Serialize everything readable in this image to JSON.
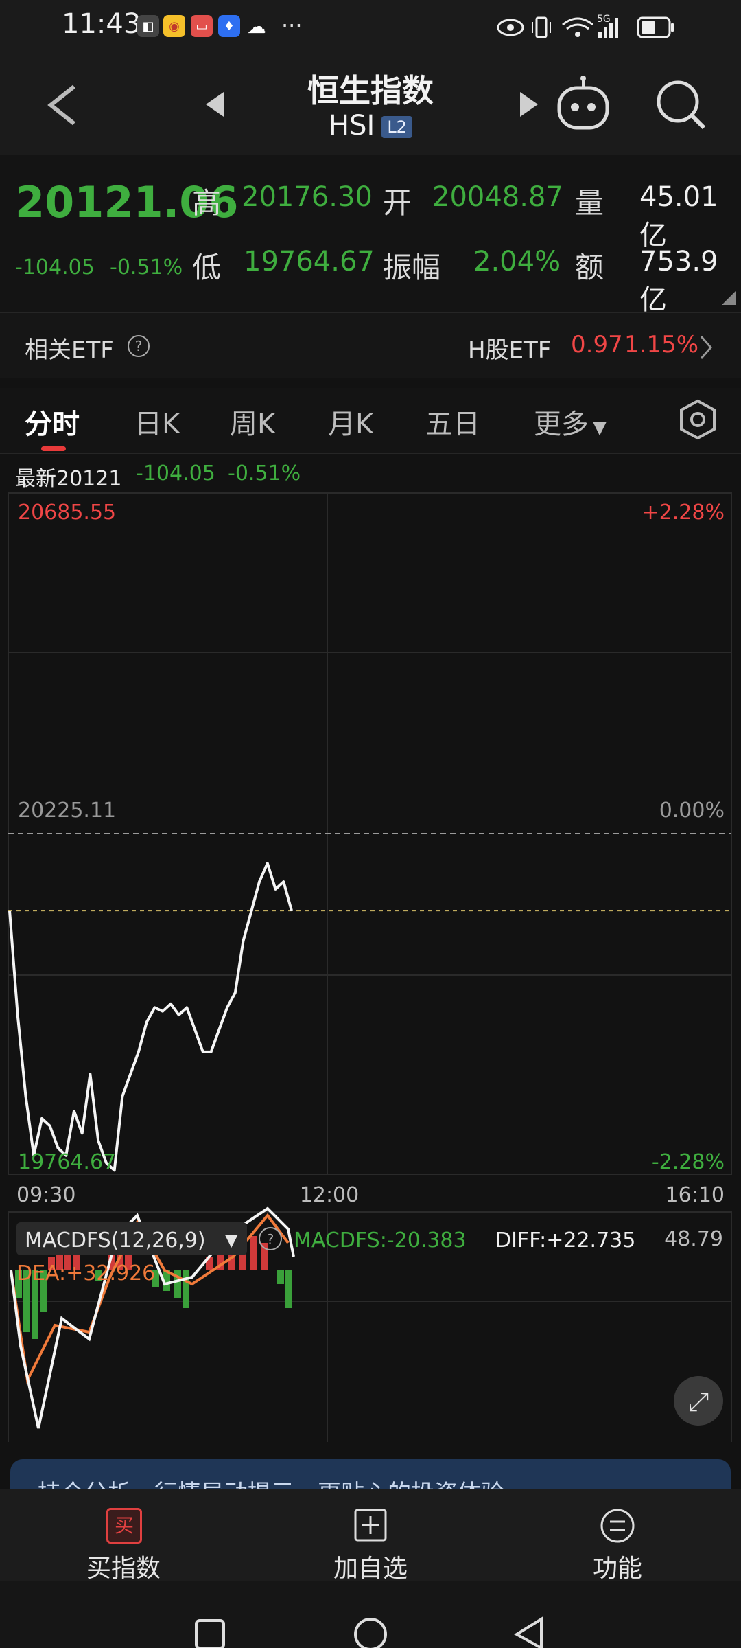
{
  "status": {
    "time": "11:43",
    "more": "···",
    "network": "5G"
  },
  "header": {
    "title": "恒生指数",
    "code": "HSI",
    "badge": "L2"
  },
  "quote": {
    "price": "20121.06",
    "change": "-104.05",
    "change_pct": "-0.51%",
    "high_label": "高",
    "high": "20176.30",
    "low_label": "低",
    "low": "19764.67",
    "open_label": "开",
    "open": "20048.87",
    "amp_label": "振幅",
    "amp": "2.04%",
    "vol_label": "量",
    "vol": "45.01亿",
    "amt_label": "额",
    "amt": "753.9亿"
  },
  "etf": {
    "label": "相关ETF",
    "name": "H股ETF",
    "price": "0.97",
    "pct": "1.15%"
  },
  "tabs": [
    "分时",
    "日K",
    "周K",
    "月K",
    "五日",
    "更多"
  ],
  "chart_info": {
    "latest_label": "最新20121",
    "change": "-104.05",
    "pct": "-0.51%"
  },
  "chart_data": [
    {
      "type": "line",
      "x_ticks": [
        "09:30",
        "12:00",
        "16:10"
      ],
      "y_ticks_left": [
        "20685.55",
        "20225.11",
        "19764.67"
      ],
      "y_ticks_right": [
        "+2.28%",
        "0.00%",
        "-2.28%"
      ],
      "ylim": [
        19764.67,
        20685.55
      ],
      "prev_close": 20225.11,
      "current": 20121.06,
      "series": [
        {
          "values": [
            20121,
            19980,
            19870,
            19790,
            19840,
            19830,
            19800,
            19790,
            19850,
            19820,
            19900,
            19810,
            19780,
            19770,
            19870,
            19900,
            19930,
            19970,
            19990,
            19985,
            19995,
            19980,
            19990,
            19960,
            19930,
            19930,
            19960,
            19990,
            20010,
            20080,
            20120,
            20160,
            20185,
            20150,
            20160,
            20121
          ]
        }
      ]
    },
    {
      "type": "bar",
      "title": "MACDFS(12,26,9)",
      "macdfs": "MACDFS:-20.383",
      "diff": "DIFF:+22.735",
      "dea": "DEA:+32.926",
      "ymax_label": "48.79"
    }
  ],
  "fullscreen": "⤢",
  "banner_text": "持仓分析、行情异动提示，更贴心的投资体验",
  "bottom": {
    "buy_icon": "买",
    "buy": "买指数",
    "add": "加自选",
    "func": "功能"
  },
  "colors": {
    "up": "#f04646",
    "down": "#3fae3f",
    "bg": "#121212"
  }
}
